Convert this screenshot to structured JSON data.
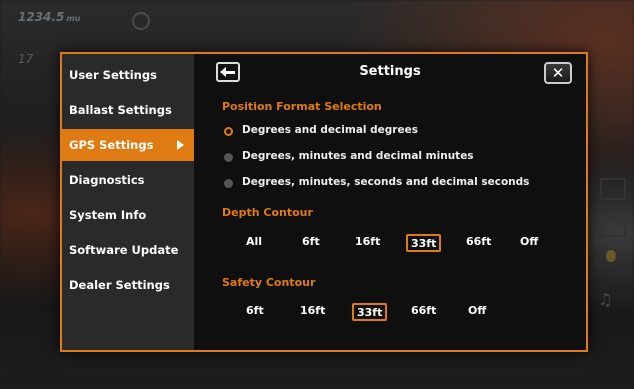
{
  "background": {
    "top_value": "1234.5",
    "top_unit": "mu",
    "second_value": "17"
  },
  "sidebar": {
    "items": [
      {
        "label": "User Settings"
      },
      {
        "label": "Ballast Settings"
      },
      {
        "label": "GPS Settings",
        "active": true
      },
      {
        "label": "Diagnostics"
      },
      {
        "label": "System Info"
      },
      {
        "label": "Software Update"
      },
      {
        "label": "Dealer Settings"
      }
    ]
  },
  "header": {
    "title": "Settings"
  },
  "position_format": {
    "label": "Position Format Selection",
    "options": [
      {
        "label": "Degrees and decimal degrees",
        "selected": true
      },
      {
        "label": "Degrees, minutes and decimal minutes",
        "selected": false
      },
      {
        "label": "Degrees, minutes, seconds and decimal seconds",
        "selected": false
      }
    ]
  },
  "depth_contour": {
    "label": "Depth Contour",
    "options": [
      "All",
      "6ft",
      "16ft",
      "33ft",
      "66ft",
      "Off"
    ],
    "selected": "33ft"
  },
  "safety_contour": {
    "label": "Safety Contour",
    "options": [
      "6ft",
      "16ft",
      "33ft",
      "66ft",
      "Off"
    ],
    "selected": "33ft"
  },
  "colors": {
    "accent": "#e07a12",
    "sidebar_bg": "#2a2a2a",
    "panel_bg": "#0f0f0f"
  }
}
